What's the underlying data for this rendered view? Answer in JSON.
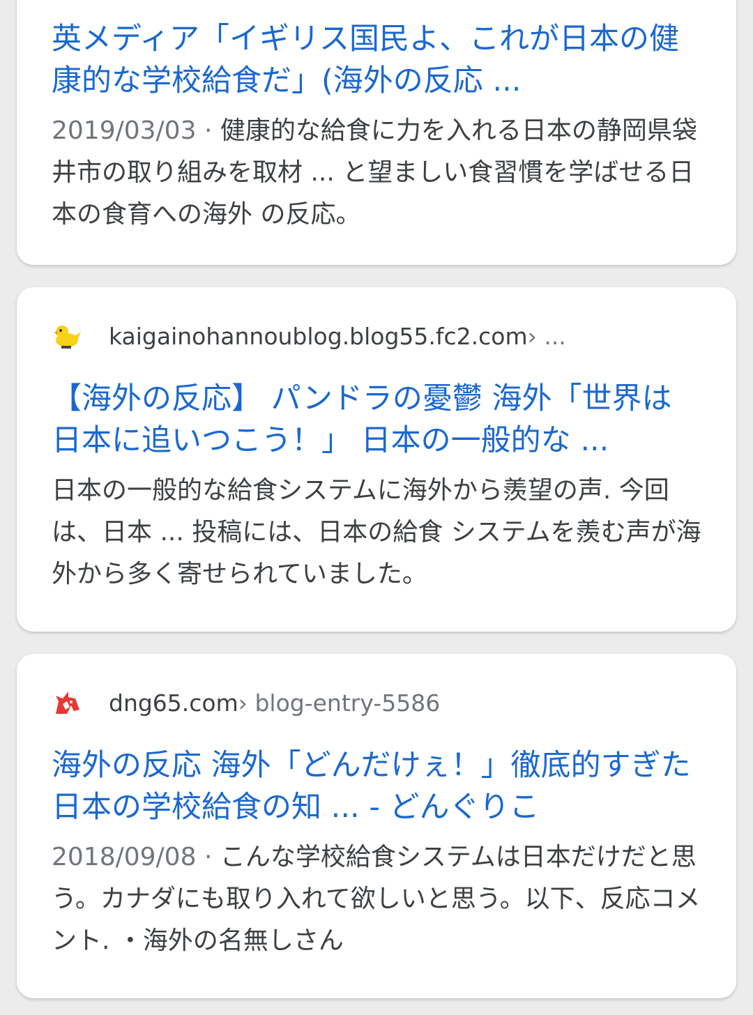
{
  "results": [
    {
      "title": "英メディア「イギリス国民よ、これが日本の健康的な学校給食だ」(海外の反応 ...",
      "date": "2019/03/03",
      "snippet": "健康的な給食に力を入れる日本の静岡県袋井市の取り組みを取材 ... と望ましい食習慣を学ばせる日本の食育への海外 の反応。"
    },
    {
      "source_url": "kaigainohannoublog.blog55.fc2.com",
      "source_path": " › ...",
      "favicon": "duck-icon",
      "title": "【海外の反応】 パンドラの憂鬱 海外「世界は日本に追いつこう！」 日本の一般的な ...",
      "snippet": "日本の一般的な給食システムに海外から羨望の声. 今回は、日本 ... 投稿には、日本の給食 システムを羨む声が海外から多く寄せられていました。"
    },
    {
      "source_url": "dng65.com",
      "source_path": " › blog-entry-5586",
      "favicon": "unicorn-icon",
      "title": "海外の反応 海外「どんだけぇ！」徹底的すぎた日本の学校給食の知 ... - どんぐりこ",
      "date": "2018/09/08",
      "snippet": "こんな学校給食システムは日本だけだと思う。カナダにも取り入れて欲しいと思う。以下、反応コメント. ・海外の名無しさん"
    }
  ],
  "separator": " · ",
  "colors": {
    "link": "#1a68d0",
    "text": "#3c4043",
    "muted": "#70757a"
  }
}
